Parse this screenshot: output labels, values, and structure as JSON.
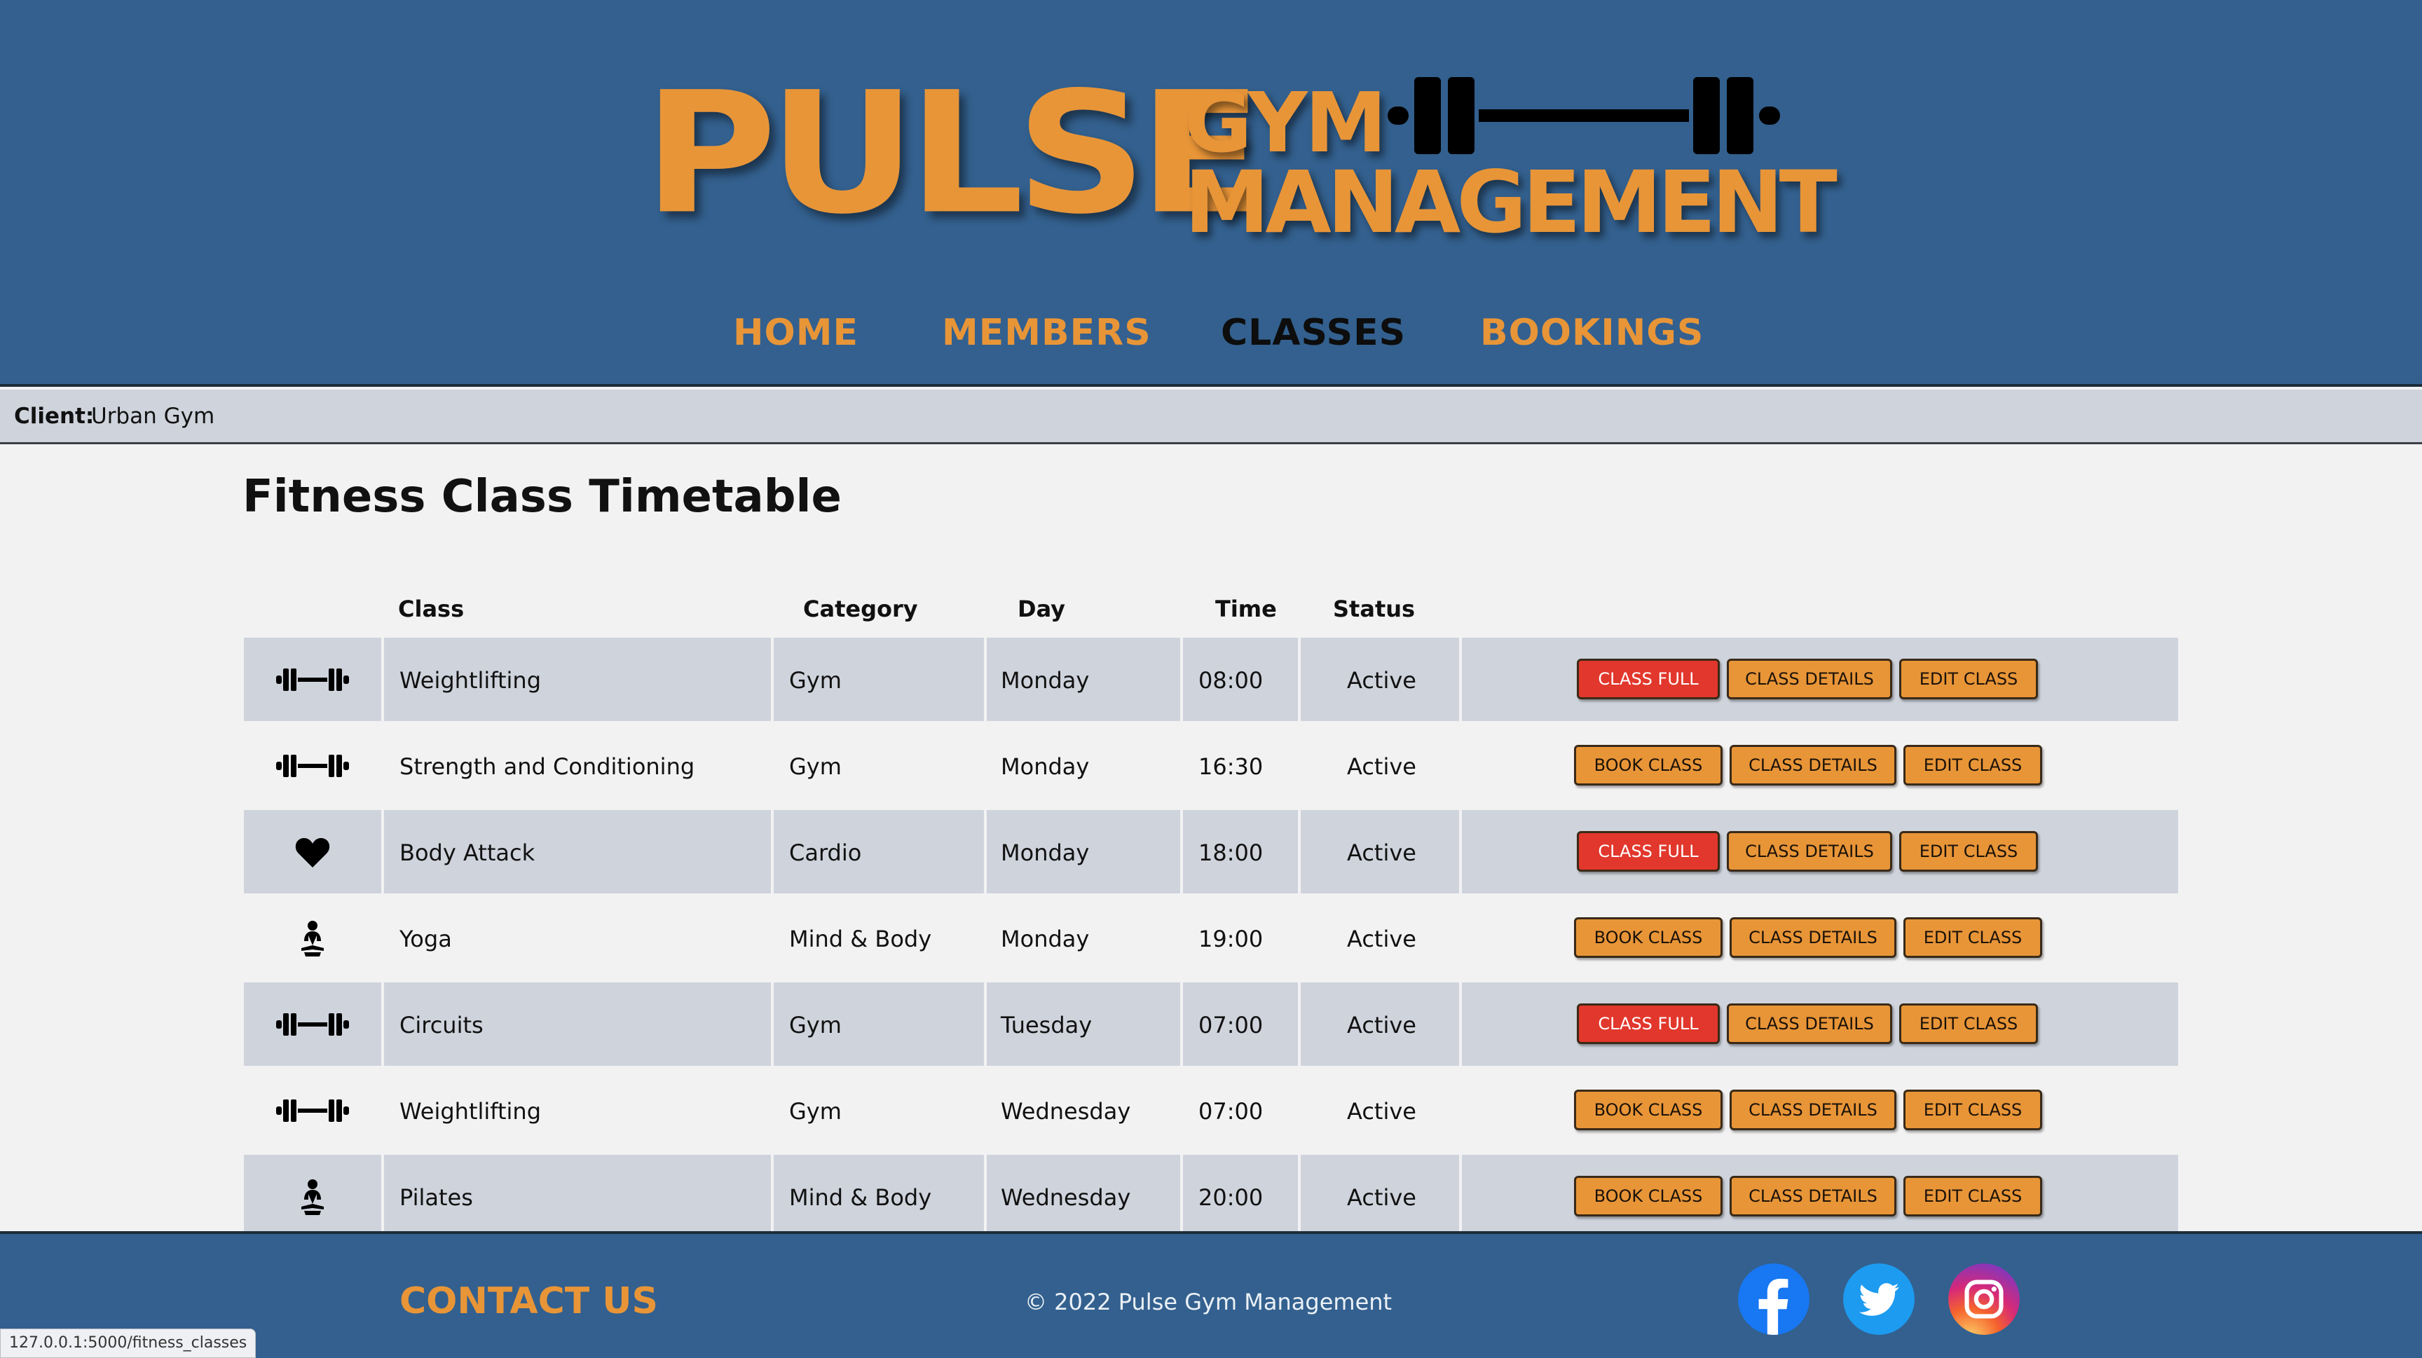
{
  "brand": {
    "logo_primary": "PULSE",
    "logo_secondary_1": "GYM",
    "logo_secondary_2": "MANAGEMENT",
    "accent_color": "#e89538",
    "header_color": "#33608e"
  },
  "nav": {
    "items": [
      {
        "label": "HOME"
      },
      {
        "label": "MEMBERS"
      },
      {
        "label": "CLASSES",
        "active": true
      },
      {
        "label": "BOOKINGS"
      }
    ]
  },
  "client": {
    "label": "Client:",
    "name": "Urban Gym"
  },
  "page": {
    "title": "Fitness Class Timetable"
  },
  "table": {
    "headers": {
      "class": "Class",
      "category": "Category",
      "day": "Day",
      "time": "Time",
      "status": "Status"
    },
    "rows": [
      {
        "icon": "barbell-icon",
        "class": "Weightlifting",
        "category": "Gym",
        "day": "Monday",
        "time": "08:00",
        "status": "Active",
        "book_label": "CLASS FULL",
        "full": true,
        "details_label": "CLASS DETAILS",
        "edit_label": "EDIT CLASS"
      },
      {
        "icon": "barbell-icon",
        "class": "Strength and Conditioning",
        "category": "Gym",
        "day": "Monday",
        "time": "16:30",
        "status": "Active",
        "book_label": "BOOK CLASS",
        "full": false,
        "details_label": "CLASS DETAILS",
        "edit_label": "EDIT CLASS"
      },
      {
        "icon": "heart-icon",
        "class": "Body Attack",
        "category": "Cardio",
        "day": "Monday",
        "time": "18:00",
        "status": "Active",
        "book_label": "CLASS FULL",
        "full": true,
        "details_label": "CLASS DETAILS",
        "edit_label": "EDIT CLASS"
      },
      {
        "icon": "meditation-icon",
        "class": "Yoga",
        "category": "Mind & Body",
        "day": "Monday",
        "time": "19:00",
        "status": "Active",
        "book_label": "BOOK CLASS",
        "full": false,
        "details_label": "CLASS DETAILS",
        "edit_label": "EDIT CLASS"
      },
      {
        "icon": "barbell-icon",
        "class": "Circuits",
        "category": "Gym",
        "day": "Tuesday",
        "time": "07:00",
        "status": "Active",
        "book_label": "CLASS FULL",
        "full": true,
        "details_label": "CLASS DETAILS",
        "edit_label": "EDIT CLASS"
      },
      {
        "icon": "barbell-icon",
        "class": "Weightlifting",
        "category": "Gym",
        "day": "Wednesday",
        "time": "07:00",
        "status": "Active",
        "book_label": "BOOK CLASS",
        "full": false,
        "details_label": "CLASS DETAILS",
        "edit_label": "EDIT CLASS"
      },
      {
        "icon": "meditation-icon",
        "class": "Pilates",
        "category": "Mind & Body",
        "day": "Wednesday",
        "time": "20:00",
        "status": "Active",
        "book_label": "BOOK CLASS",
        "full": false,
        "details_label": "CLASS DETAILS",
        "edit_label": "EDIT CLASS"
      }
    ]
  },
  "footer": {
    "contact_label": "CONTACT US",
    "copyright": "© 2022 Pulse Gym Management",
    "social": [
      "facebook-icon",
      "twitter-icon",
      "instagram-icon"
    ]
  },
  "status_bar": {
    "url": "127.0.0.1:5000/fitness_classes"
  },
  "colors": {
    "class_full": "#e2372c",
    "button": "#e89538",
    "row_shade": "#cfd3dc"
  }
}
